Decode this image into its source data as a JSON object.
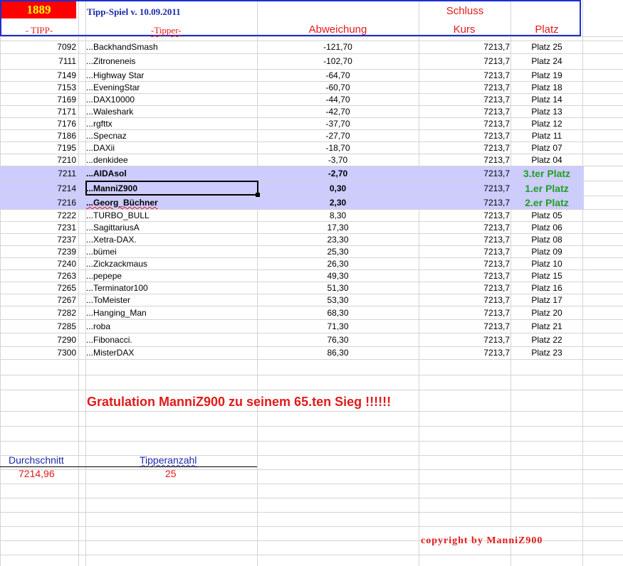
{
  "header": {
    "badge": "1889",
    "title": "Tipp-Spiel v. 10.09.2011",
    "schluss": "Schluss",
    "col_tipp": "- TIPP-",
    "col_tipper": "-Tipper-",
    "col_abweichung": "Abweichung",
    "col_kurs": "Kurs",
    "col_platz": "Platz"
  },
  "rows": [
    {
      "tipp": "7092",
      "name": "...BackhandSmash",
      "abw": "-121,70",
      "kurs": "7213,7",
      "platz": "Platz 25"
    },
    {
      "tipp": "7111",
      "name": "...Zitroneneis",
      "abw": "-102,70",
      "kurs": "7213,7",
      "platz": "Platz 24"
    },
    {
      "tipp": "7149",
      "name": "...Highway Star",
      "abw": "-64,70",
      "kurs": "7213,7",
      "platz": "Platz 19"
    },
    {
      "tipp": "7153",
      "name": "...EveningStar",
      "abw": "-60,70",
      "kurs": "7213,7",
      "platz": "Platz 18"
    },
    {
      "tipp": "7169",
      "name": "...DAX10000",
      "abw": "-44,70",
      "kurs": "7213,7",
      "platz": "Platz 14"
    },
    {
      "tipp": "7171",
      "name": "...Waleshark",
      "abw": "-42,70",
      "kurs": "7213,7",
      "platz": "Platz 13"
    },
    {
      "tipp": "7176",
      "name": "...rgfttx",
      "abw": "-37,70",
      "kurs": "7213,7",
      "platz": "Platz 12"
    },
    {
      "tipp": "7186",
      "name": "...Specnaz",
      "abw": "-27,70",
      "kurs": "7213,7",
      "platz": "Platz 11"
    },
    {
      "tipp": "7195",
      "name": "...DAXii",
      "abw": "-18,70",
      "kurs": "7213,7",
      "platz": "Platz 07"
    },
    {
      "tipp": "7210",
      "name": "...denkidee",
      "abw": "-3,70",
      "kurs": "7213,7",
      "platz": "Platz 04"
    },
    {
      "tipp": "7211",
      "name": "...AIDAsol",
      "abw": "-2,70",
      "kurs": "7213,7",
      "platz": "3.ter Platz",
      "highlight": true
    },
    {
      "tipp": "7214",
      "name": "...ManniZ900",
      "abw": "0,30",
      "kurs": "7213,7",
      "platz": "1.er Platz",
      "highlight": true
    },
    {
      "tipp": "7216",
      "name": "...Georg_Büchner",
      "abw": "2,30",
      "kurs": "7213,7",
      "platz": "2.er Platz",
      "highlight": true
    },
    {
      "tipp": "7222",
      "name": "...TURBO_BULL",
      "abw": "8,30",
      "kurs": "7213,7",
      "platz": "Platz 05"
    },
    {
      "tipp": "7231",
      "name": "...SagittariusA",
      "abw": "17,30",
      "kurs": "7213,7",
      "platz": "Platz 06"
    },
    {
      "tipp": "7237",
      "name": "...Xetra-DAX.",
      "abw": "23,30",
      "kurs": "7213,7",
      "platz": "Platz 08"
    },
    {
      "tipp": "7239",
      "name": "...bümei",
      "abw": "25,30",
      "kurs": "7213,7",
      "platz": "Platz 09"
    },
    {
      "tipp": "7240",
      "name": "...Zickzackmaus",
      "abw": "26,30",
      "kurs": "7213,7",
      "platz": "Platz 10"
    },
    {
      "tipp": "7263",
      "name": "...pepepe",
      "abw": "49,30",
      "kurs": "7213,7",
      "platz": "Platz 15"
    },
    {
      "tipp": "7265",
      "name": "...Terminator100",
      "abw": "51,30",
      "kurs": "7213,7",
      "platz": "Platz 16"
    },
    {
      "tipp": "7267",
      "name": "...ToMeister",
      "abw": "53,30",
      "kurs": "7213,7",
      "platz": "Platz 17"
    },
    {
      "tipp": "7282",
      "name": "...Hanging_Man",
      "abw": "68,30",
      "kurs": "7213,7",
      "platz": "Platz 20"
    },
    {
      "tipp": "7285",
      "name": "...roba",
      "abw": "71,30",
      "kurs": "7213,7",
      "platz": "Platz 21"
    },
    {
      "tipp": "7290",
      "name": "...Fibonacci.",
      "abw": "76,30",
      "kurs": "7213,7",
      "platz": "Platz 22"
    },
    {
      "tipp": "7300",
      "name": "...MisterDAX",
      "abw": "86,30",
      "kurs": "7213,7",
      "platz": "Platz 23"
    }
  ],
  "congrats": "Gratulation  ManniZ900  zu seinem 65.ten Sieg !!!!!!",
  "stats": {
    "avg_label": "Durchschnitt",
    "avg_value": "7214,96",
    "count_label": "Tipperanzahl",
    "count_value": "25"
  },
  "copyright": "copyright by ManniZ900"
}
